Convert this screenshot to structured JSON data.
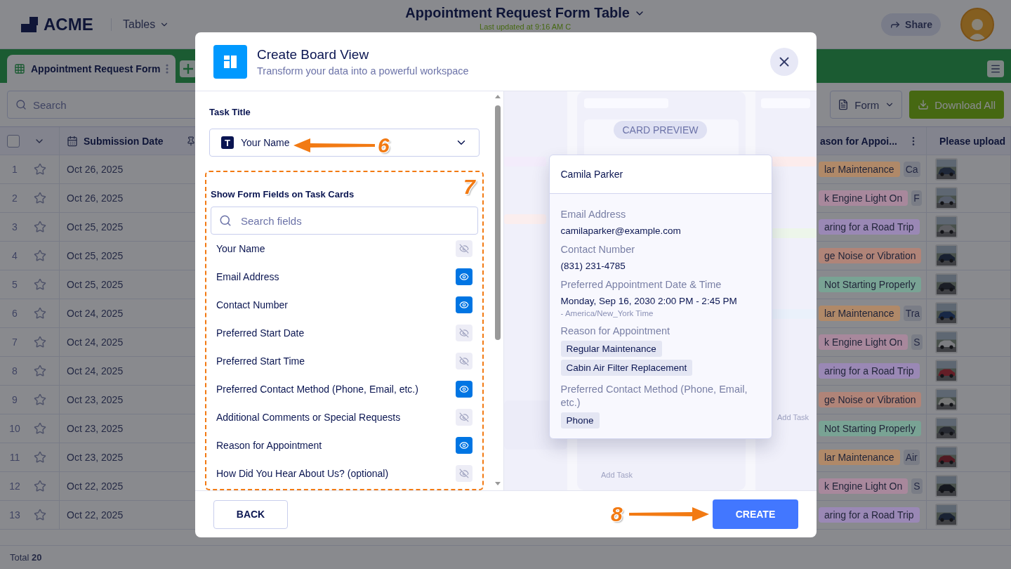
{
  "header": {
    "logo": "ACME",
    "nav": "Tables",
    "title": "Appointment Request Form Table",
    "subtitle": "Last updated at 9:16 AM C",
    "share": "Share"
  },
  "tabs": [
    {
      "label": "Appointment Request Form",
      "selected": true
    }
  ],
  "toolbar": {
    "search_placeholder": "Search",
    "view": "Form",
    "download": "Download All"
  },
  "table": {
    "select_all_checked": false,
    "columns": [
      "Submission Date",
      "ason for Appoi...",
      "Please upload"
    ],
    "rows": [
      {
        "number": "1",
        "starred": false,
        "date": "Oct 26, 2025",
        "tag": {
          "text": "lar Maintenance",
          "color": "#b08968"
        },
        "extra": "Ca"
      },
      {
        "number": "2",
        "starred": false,
        "date": "Oct 26, 2025",
        "tag": {
          "text": "k Engine Light On",
          "color": "#a8889c"
        },
        "extra": "F"
      },
      {
        "number": "3",
        "starred": false,
        "date": "Oct 25, 2025",
        "tag": {
          "text": "aring for a Road Trip",
          "color": "#9a88b5"
        }
      },
      {
        "number": "4",
        "starred": false,
        "date": "Oct 25, 2025",
        "tag": {
          "text": "ge Noise or Vibration",
          "color": "#b08478"
        }
      },
      {
        "number": "5",
        "starred": false,
        "date": "Oct 25, 2025",
        "tag": {
          "text": "Not Starting Properly",
          "color": "#79a394"
        }
      },
      {
        "number": "6",
        "starred": false,
        "date": "Oct 24, 2025",
        "tag": {
          "text": "lar Maintenance",
          "color": "#b08968"
        },
        "extra": "Tra"
      },
      {
        "number": "7",
        "starred": false,
        "date": "Oct 24, 2025",
        "tag": {
          "text": "k Engine Light On",
          "color": "#a8889c"
        },
        "extra": "S"
      },
      {
        "number": "8",
        "starred": false,
        "date": "Oct 24, 2025",
        "tag": {
          "text": "aring for a Road Trip",
          "color": "#9a88b5"
        }
      },
      {
        "number": "9",
        "starred": false,
        "date": "Oct 23, 2025",
        "tag": {
          "text": "ge Noise or Vibration",
          "color": "#b08478"
        }
      },
      {
        "number": "10",
        "starred": false,
        "date": "Oct 23, 2025",
        "tag": {
          "text": "Not Starting Properly",
          "color": "#79a394"
        }
      },
      {
        "number": "11",
        "starred": false,
        "date": "Oct 23, 2025",
        "tag": {
          "text": "lar Maintenance",
          "color": "#b08968"
        },
        "extra": "Air"
      },
      {
        "number": "12",
        "starred": false,
        "date": "Oct 22, 2025",
        "tag": {
          "text": "k Engine Light On",
          "color": "#a8889c"
        },
        "extra": "S"
      },
      {
        "number": "13",
        "starred": false,
        "date": "Oct 22, 2025",
        "tag": {
          "text": "aring for a Road Trip",
          "color": "#9a88b5"
        }
      }
    ]
  },
  "footer": {
    "total": "Total **20**"
  },
  "modal": {
    "title": "Create Board View",
    "subtitle": "Transform your data into a powerful workspace",
    "task_title_label": "Task Title",
    "task_title_icon": "T",
    "task_title_value": "Your Name",
    "fields_heading": "Show Form Fields on Task Cards",
    "fields_search_placeholder": "Search fields",
    "fields": [
      {
        "label": "Your Name",
        "visible": false
      },
      {
        "label": "Email Address",
        "visible": true
      },
      {
        "label": "Contact Number",
        "visible": true
      },
      {
        "label": "Preferred Start Date",
        "visible": false
      },
      {
        "label": "Preferred Start Time",
        "visible": false
      },
      {
        "label": "Preferred Contact Method (Phone, Email, etc.)",
        "visible": true
      },
      {
        "label": "Additional Comments or Special Requests",
        "visible": false
      },
      {
        "label": "Reason for Appointment",
        "visible": true
      },
      {
        "label": "How Did You Hear About Us? (optional)",
        "visible": false
      }
    ],
    "preview_badge": "CARD PREVIEW",
    "ghost_labels": [
      "Add Task",
      "Add Task"
    ],
    "card": {
      "title": "Camila Parker",
      "fields": [
        {
          "label": "Email Address",
          "kind": "text",
          "value": "camilaparker@example.com"
        },
        {
          "label": "Contact Number",
          "kind": "text",
          "value": "(831) 231-4785"
        },
        {
          "label": "Preferred Appointment Date & Time",
          "kind": "datetime",
          "value": "Monday, Sep 16, 2030 2:00 PM - 2:45 PM",
          "note": "- America/New_York Time"
        },
        {
          "label": "Reason for Appointment",
          "kind": "tags",
          "tags": [
            "Regular Maintenance",
            "Cabin Air Filter Replacement"
          ]
        },
        {
          "label": "Preferred Contact Method (Phone, Email, etc.)",
          "kind": "tags",
          "tags": [
            "Phone"
          ]
        }
      ]
    },
    "back": "BACK",
    "create": "CREATE"
  },
  "annotations": [
    "6",
    "7",
    "8"
  ]
}
